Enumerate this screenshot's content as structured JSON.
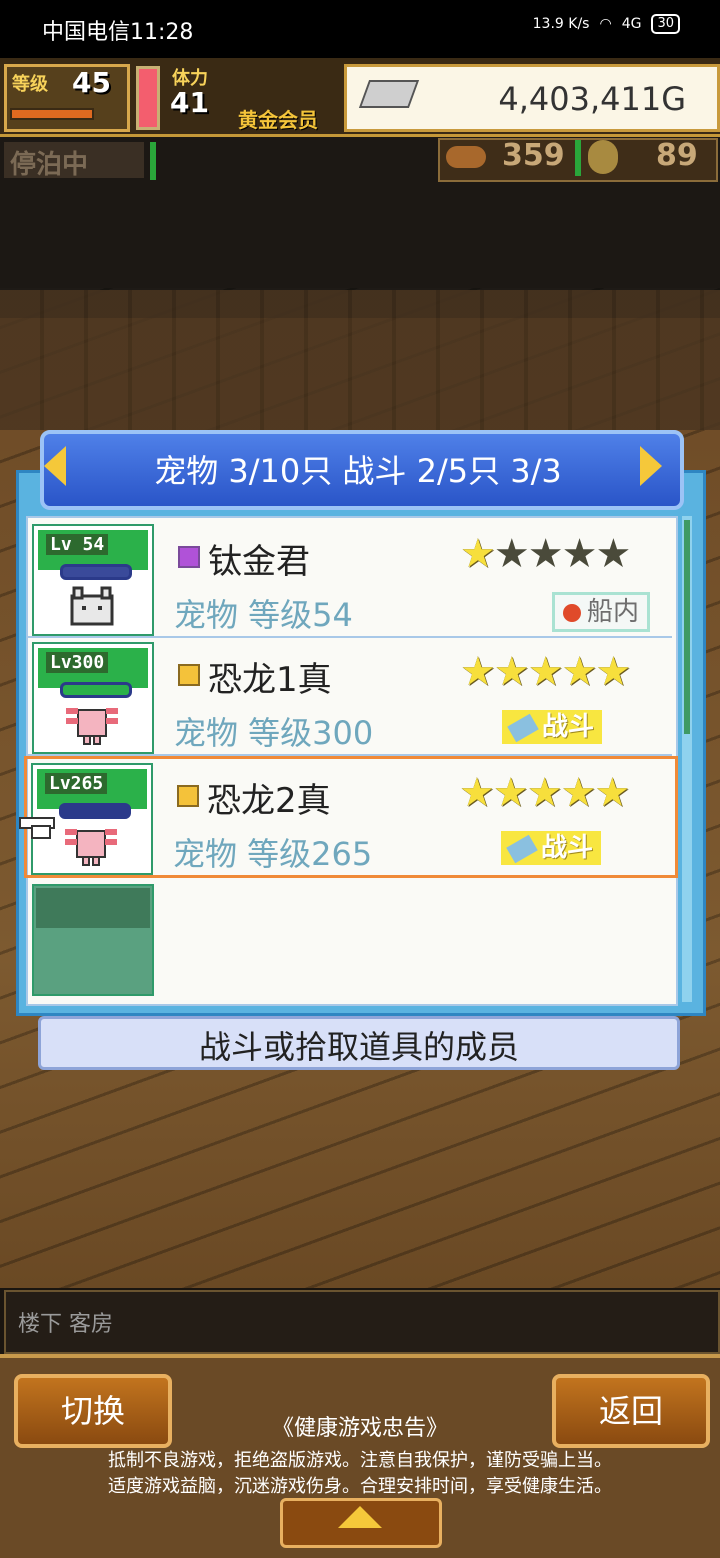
{
  "status_bar": {
    "carrier_time": "中国电信11:28",
    "net_speed": "13.9 K/s",
    "signal": "4G",
    "battery": "30"
  },
  "hud": {
    "level_label": "等级",
    "level_value": "45",
    "stamina_label": "体力",
    "stamina_value": "41",
    "member_label": "黄金会员",
    "gold": "4,403,411G",
    "moored_label": "停泊中",
    "counter1": "359",
    "counter2": "89"
  },
  "panel": {
    "title": "宠物 3/10只 战斗 2/5只  3/3",
    "caption": "战斗或拾取道具的成员"
  },
  "pets": [
    {
      "lv": "Lv 54",
      "name": "钛金君",
      "sub": "宠物 等级54",
      "stars_on": 1,
      "stars_total": 5,
      "tag": "船内"
    },
    {
      "lv": "Lv300",
      "name": "恐龙1真",
      "sub": "宠物 等级300",
      "stars_on": 5,
      "stars_total": 5,
      "tag": "战斗"
    },
    {
      "lv": "Lv265",
      "name": "恐龙2真",
      "sub": "宠物 等级265",
      "stars_on": 5,
      "stars_total": 5,
      "tag": "战斗"
    }
  ],
  "footer": {
    "location": "楼下 客房",
    "switch_label": "切换",
    "back_label": "返回",
    "notice_title": "《健康游戏忠告》",
    "notice_line1": "抵制不良游戏，拒绝盗版游戏。注意自我保护，谨防受骗上当。",
    "notice_line2": "适度游戏益脑，沉迷游戏伤身。合理安排时间，享受健康生活。"
  }
}
